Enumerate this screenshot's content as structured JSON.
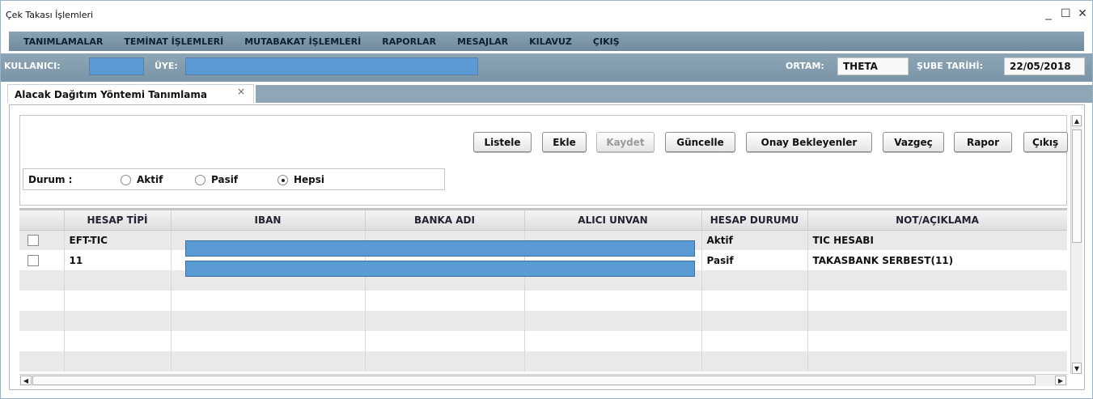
{
  "window": {
    "title": "Çek Takası İşlemleri"
  },
  "menu": [
    "TANIMLAMALAR",
    "TEMİNAT İŞLEMLERİ",
    "MUTABAKAT İŞLEMLERİ",
    "RAPORLAR",
    "MESAJLAR",
    "KILAVUZ",
    "ÇIKIŞ"
  ],
  "userbar": {
    "user_label": "KULLANICI:",
    "member_label": "ÜYE:",
    "env_label": "ORTAM:",
    "env_value": "THETA",
    "date_label": "ŞUBE TARİHİ:",
    "date_value": "22/05/2018"
  },
  "tab": {
    "label": "Alacak Dağıtım Yöntemi Tanımlama",
    "close": "×"
  },
  "buttons": {
    "list": "Listele",
    "add": "Ekle",
    "save": "Kaydet",
    "update": "Güncelle",
    "pending": "Onay Bekleyenler",
    "cancel": "Vazgeç",
    "report": "Rapor",
    "exit": "Çıkış"
  },
  "filter": {
    "label": "Durum  :",
    "options": [
      {
        "label": "Aktif",
        "selected": false
      },
      {
        "label": "Pasif",
        "selected": false
      },
      {
        "label": "Hepsi",
        "selected": true
      }
    ]
  },
  "grid": {
    "columns": [
      "",
      "HESAP TİPİ",
      "IBAN",
      "BANKA ADI",
      "ALICI UNVAN",
      "HESAP DURUMU",
      "NOT/AÇIKLAMA"
    ],
    "rows": [
      {
        "hesap_tipi": "EFT-TIC",
        "hesap_durumu": "Aktif",
        "not": "TIC HESABI"
      },
      {
        "hesap_tipi": "11",
        "hesap_durumu": "Pasif",
        "not": "TAKASBANK SERBEST(11)"
      }
    ]
  },
  "colors": {
    "accent_blue": "#5b9bd5",
    "menubar": "#7b96a8"
  }
}
